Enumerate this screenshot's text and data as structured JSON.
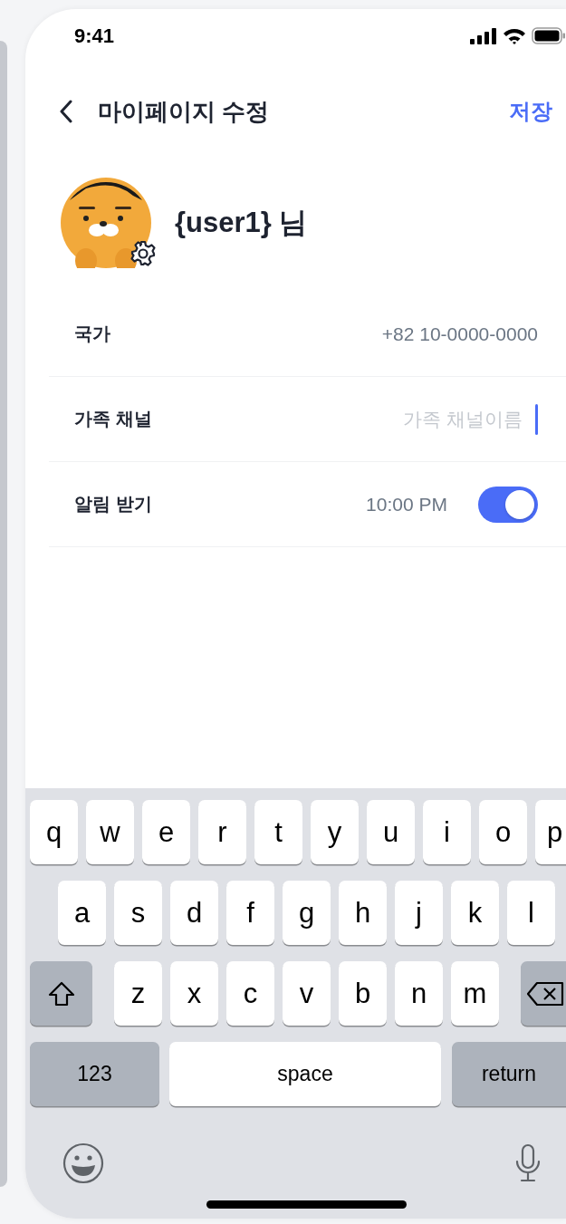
{
  "status_bar": {
    "time": "9:41"
  },
  "header": {
    "title": "마이페이지 수정",
    "action": "저장"
  },
  "profile": {
    "name": "{user1} 님"
  },
  "fields": [
    {
      "kind": "text",
      "label": "국가",
      "value": "+82 10-0000-0000"
    },
    {
      "kind": "input",
      "label": "가족 채널",
      "placeholder": "가족 채널이름",
      "focused": true
    },
    {
      "kind": "toggle",
      "label": "알림 받기",
      "value": "10:00 PM",
      "on": true
    }
  ],
  "keyboard": {
    "rows": [
      [
        {
          "kind": "letter",
          "label": "q"
        },
        {
          "kind": "letter",
          "label": "w"
        },
        {
          "kind": "letter",
          "label": "e"
        },
        {
          "kind": "letter",
          "label": "r"
        },
        {
          "kind": "letter",
          "label": "t"
        },
        {
          "kind": "letter",
          "label": "y"
        },
        {
          "kind": "letter",
          "label": "u"
        },
        {
          "kind": "letter",
          "label": "i"
        },
        {
          "kind": "letter",
          "label": "o"
        },
        {
          "kind": "letter",
          "label": "p"
        }
      ],
      [
        {
          "kind": "letter",
          "label": "a"
        },
        {
          "kind": "letter",
          "label": "s"
        },
        {
          "kind": "letter",
          "label": "d"
        },
        {
          "kind": "letter",
          "label": "f"
        },
        {
          "kind": "letter",
          "label": "g"
        },
        {
          "kind": "letter",
          "label": "h"
        },
        {
          "kind": "letter",
          "label": "j"
        },
        {
          "kind": "letter",
          "label": "k"
        },
        {
          "kind": "letter",
          "label": "l"
        }
      ],
      [
        {
          "kind": "shift"
        },
        {
          "kind": "letter",
          "label": "z"
        },
        {
          "kind": "letter",
          "label": "x"
        },
        {
          "kind": "letter",
          "label": "c"
        },
        {
          "kind": "letter",
          "label": "v"
        },
        {
          "kind": "letter",
          "label": "b"
        },
        {
          "kind": "letter",
          "label": "n"
        },
        {
          "kind": "letter",
          "label": "m"
        },
        {
          "kind": "backspace"
        }
      ]
    ],
    "numbers_key": "123",
    "space_key": "space",
    "return_key": "return"
  }
}
